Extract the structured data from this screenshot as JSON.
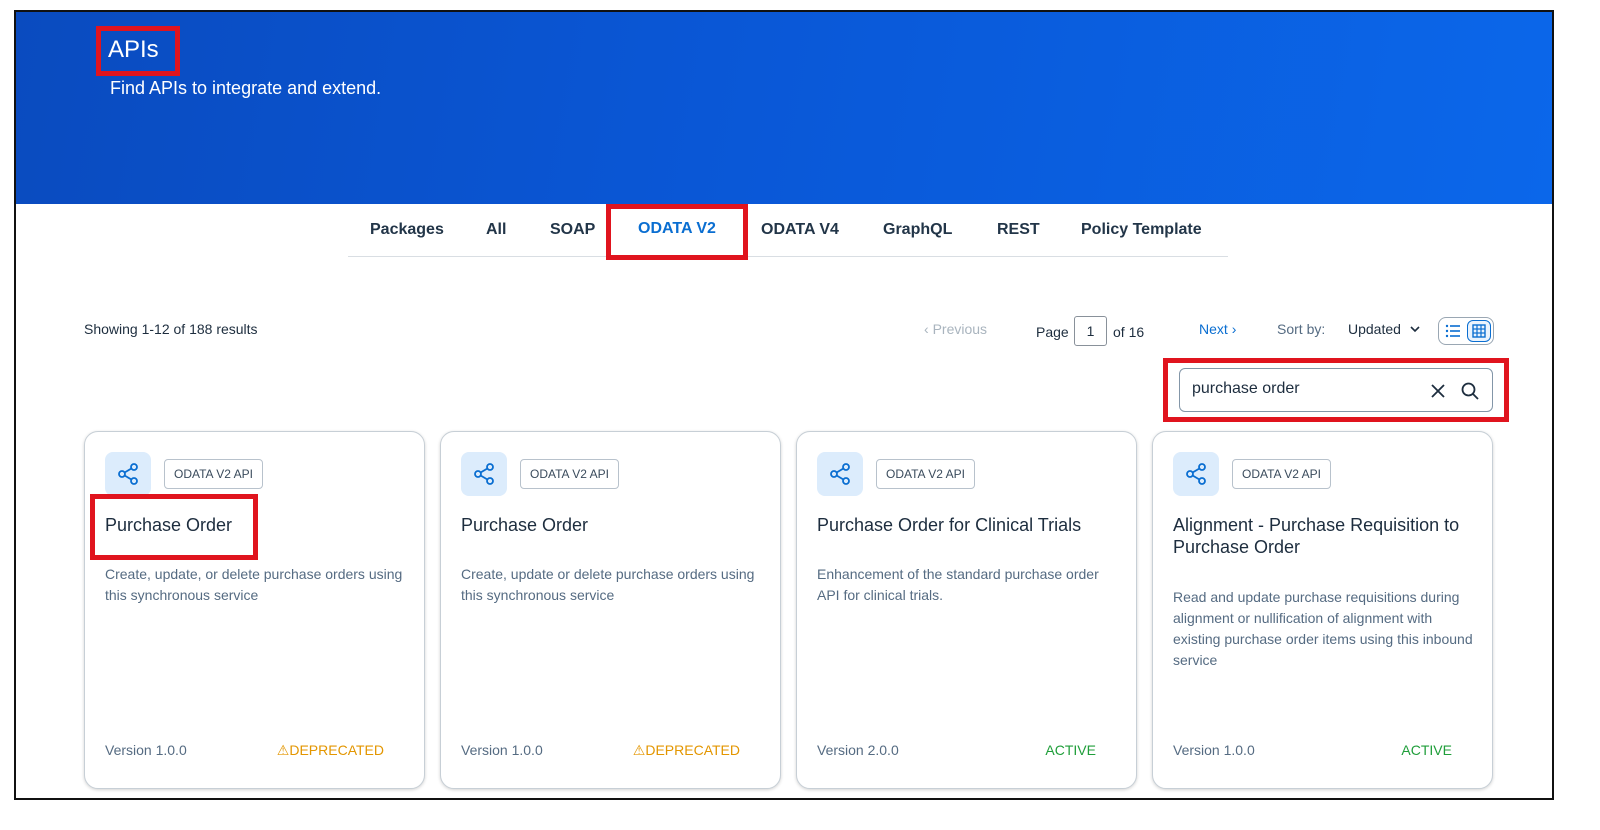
{
  "header": {
    "title": "APIs",
    "subtitle": "Find APIs to integrate and extend."
  },
  "tabs": [
    {
      "label": "Packages",
      "active": false
    },
    {
      "label": "All",
      "active": false
    },
    {
      "label": "SOAP",
      "active": false
    },
    {
      "label": "ODATA V2",
      "active": true
    },
    {
      "label": "ODATA V4",
      "active": false
    },
    {
      "label": "GraphQL",
      "active": false
    },
    {
      "label": "REST",
      "active": false
    },
    {
      "label": "Policy Template",
      "active": false
    }
  ],
  "toolbar": {
    "results_text": "Showing 1-12 of 188 results",
    "previous_label": "Previous",
    "page_label": "Page",
    "page_value": "1",
    "page_of": "of 16",
    "next_label": "Next",
    "sort_label": "Sort by:",
    "sort_value": "Updated"
  },
  "search": {
    "value": "purchase order"
  },
  "cards": [
    {
      "tag": "ODATA V2 API",
      "title": "Purchase Order",
      "description": "Create, update, or delete purchase orders using this synchronous service",
      "version": "Version 1.0.0",
      "status": "DEPRECATED"
    },
    {
      "tag": "ODATA V2 API",
      "title": "Purchase Order",
      "description": "Create, update or delete purchase orders using this synchronous service",
      "version": "Version 1.0.0",
      "status": "DEPRECATED"
    },
    {
      "tag": "ODATA V2 API",
      "title": "Purchase Order for Clinical Trials",
      "description": "Enhancement of the standard purchase order API for clinical trials.",
      "version": "Version 2.0.0",
      "status": "ACTIVE"
    },
    {
      "tag": "ODATA V2 API",
      "title": "Alignment - Purchase Requisition to Purchase Order",
      "description": "Read and update purchase requisitions during alignment or nullification of alignment with existing purchase order items using this inbound service",
      "version": "Version 1.0.0",
      "status": "ACTIVE"
    }
  ],
  "icons": {
    "card_icon": "share-icon",
    "previous": "chevron-left-icon",
    "next": "chevron-right-icon",
    "sort": "chevron-down-icon",
    "list_view": "list-icon",
    "grid_view": "grid-icon",
    "clear": "close-icon",
    "search": "search-icon",
    "warning": "warning-icon"
  },
  "colors": {
    "hero_start": "#0a4bbf",
    "hero_end": "#0b67ea",
    "accent": "#0a6ed1",
    "highlight": "#e0141e",
    "deprecated": "#e39600",
    "active": "#1f9e3a"
  }
}
